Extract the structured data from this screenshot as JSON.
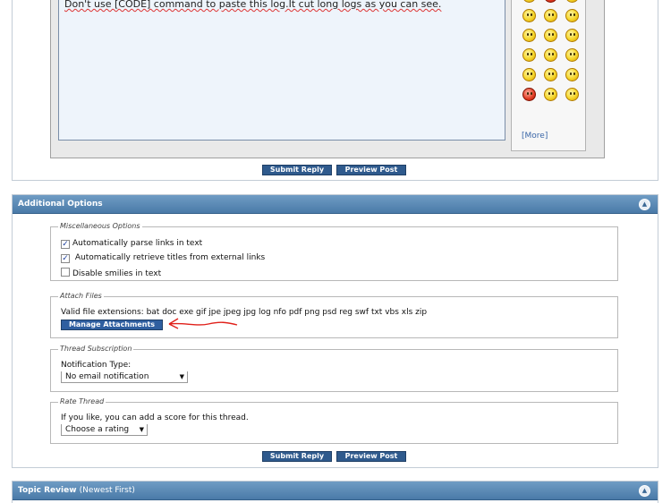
{
  "editor": {
    "text": "Don't use [CODE] command to paste this log.It cut long logs as you can see.",
    "more_link": "[More]",
    "smilies": [
      "smile",
      "grin",
      "wink",
      "mad",
      "red-face",
      "tongue",
      "roll-eyes",
      "cool",
      "big-grin",
      "eek",
      "frown",
      "confused",
      "rolleyes",
      "thumbs",
      "devil",
      "laugh",
      "cheesy",
      "evil"
    ]
  },
  "buttons": {
    "submit_reply": "Submit Reply",
    "preview_post": "Preview Post"
  },
  "additional_options": {
    "title": "Additional Options",
    "misc": {
      "legend": "Miscellaneous Options",
      "options": [
        {
          "label": "Automatically parse links in text",
          "checked": true
        },
        {
          "label": "Automatically retrieve titles from external links",
          "checked": true
        },
        {
          "label": "Disable smilies in text",
          "checked": false
        }
      ]
    },
    "attach": {
      "legend": "Attach Files",
      "extensions": "Valid file extensions: bat doc exe gif jpe jpeg jpg log nfo pdf png psd reg swf txt vbs xls zip",
      "manage_button": "Manage Attachments"
    },
    "subscription": {
      "legend": "Thread Subscription",
      "label": "Notification Type:",
      "selected": "No email notification"
    },
    "rate": {
      "legend": "Rate Thread",
      "label": "If you like, you can add a score for this thread.",
      "selected": "Choose a rating"
    }
  },
  "topic_review": {
    "title": "Topic Review",
    "subtitle": "(Newest First)"
  },
  "colors": {
    "header_blue": "#4a7aa8",
    "button_blue": "#2f5a8d",
    "annotation_red": "#e0201a"
  }
}
